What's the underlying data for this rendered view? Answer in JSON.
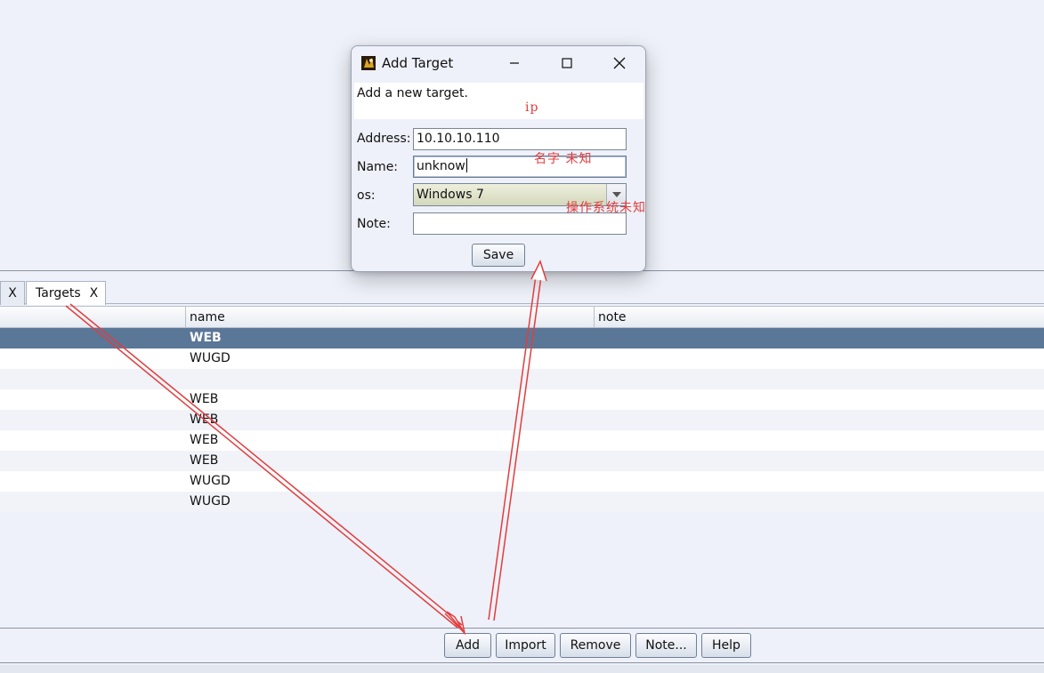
{
  "dialog": {
    "title": "Add Target",
    "description": "Add a new target.",
    "fields": {
      "address_label": "Address:",
      "address_value": "10.10.10.110",
      "name_label": "Name:",
      "name_value": "unknow",
      "os_label": "os:",
      "os_value": "Windows 7",
      "note_label": "Note:",
      "note_value": ""
    },
    "save_label": "Save"
  },
  "tabs": [
    {
      "label": "",
      "close": "X"
    },
    {
      "label": "Targets",
      "close": "X"
    }
  ],
  "table": {
    "columns": [
      "name",
      "note"
    ],
    "rows": [
      {
        "name": "WEB",
        "note": "",
        "selected": true
      },
      {
        "name": "WUGD",
        "note": ""
      },
      {
        "name": "",
        "note": ""
      },
      {
        "name": "WEB",
        "note": ""
      },
      {
        "name": "WEB",
        "note": ""
      },
      {
        "name": "WEB",
        "note": ""
      },
      {
        "name": "WEB",
        "note": ""
      },
      {
        "name": "WUGD",
        "note": ""
      },
      {
        "name": "WUGD",
        "note": ""
      }
    ]
  },
  "toolbar": {
    "add_label": "Add",
    "import_label": "Import",
    "remove_label": "Remove",
    "note_label": "Note...",
    "help_label": "Help"
  },
  "annotations": {
    "ip": "ip",
    "name_unknown": "名字 未知",
    "os_unknown": "操作系统未知",
    "color": "#e23d3d"
  },
  "colors": {
    "selected_row": "#5b7797",
    "background": "#eef1f9",
    "os_select": "#d3d8bb"
  }
}
